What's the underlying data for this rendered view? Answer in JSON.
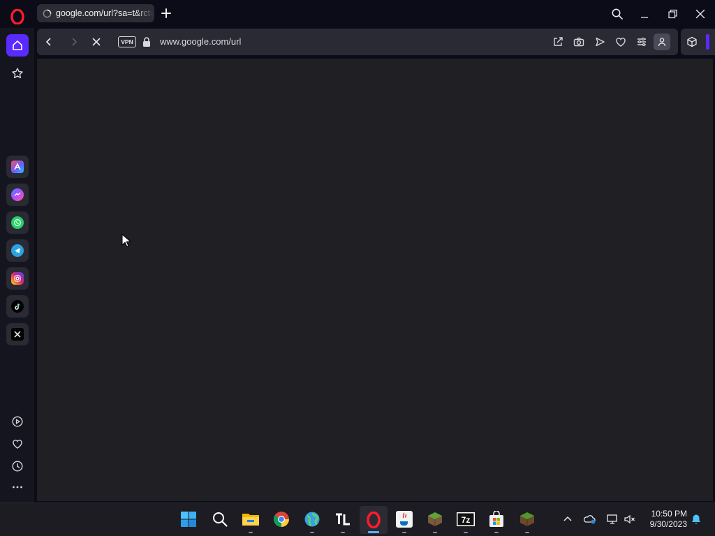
{
  "browser": {
    "tab": {
      "title": "google.com/url?sa=t&rct=j"
    },
    "address": {
      "url": "www.google.com/url",
      "vpn_label": "VPN"
    },
    "sidebar_top": [
      "home-icon",
      "star-icon"
    ],
    "sidebar_apps": [
      "aria-icon",
      "messenger-icon",
      "whatsapp-icon",
      "telegram-icon",
      "instagram-icon",
      "tiktok-icon",
      "x-icon"
    ],
    "sidebar_bottom": [
      "player-icon",
      "heart-icon",
      "history-icon",
      "more-icon"
    ],
    "toolbar_icons": [
      "snapshot-share-icon",
      "camera-icon",
      "send-icon",
      "heart-icon",
      "easy-setup-icon",
      "profile-icon",
      "extensions-cube-icon"
    ]
  },
  "taskbar": {
    "apps": [
      "start-icon",
      "search-icon",
      "file-explorer-icon",
      "chrome-icon",
      "globe-app-icon",
      "tlauncher-icon",
      "opera-icon",
      "java-icon",
      "minecraft-icon",
      "7zip-icon",
      "ms-store-icon",
      "minecraft-launcher-icon"
    ],
    "tray": [
      "chevron-up-icon",
      "onedrive-icon",
      "network-icon",
      "volume-muted-icon"
    ],
    "time": "10:50 PM",
    "date": "9/30/2023"
  },
  "colors": {
    "accent": "#5a2bff",
    "opera_red": "#ff1b2d",
    "content_bg": "#202024"
  }
}
